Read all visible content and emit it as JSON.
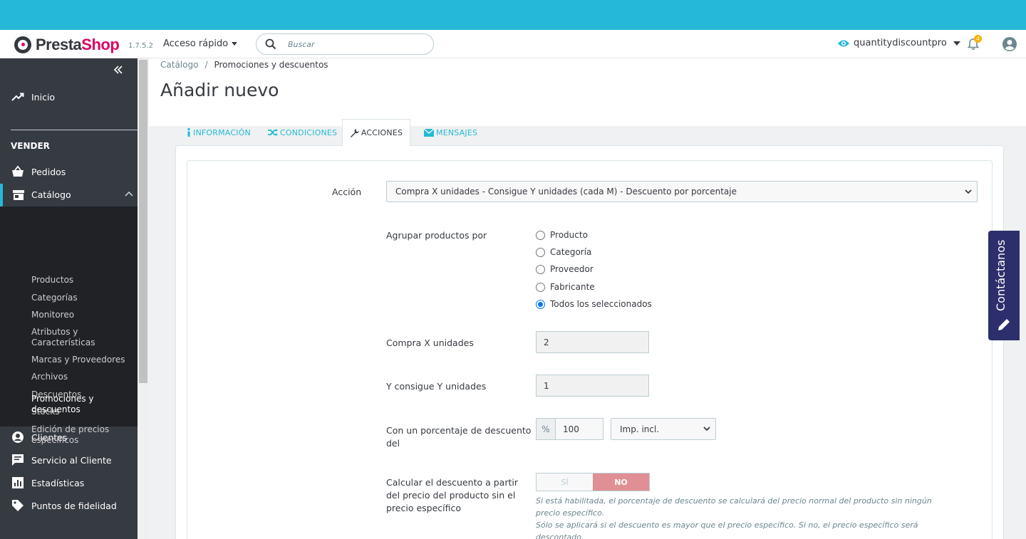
{
  "brand": {
    "name_a": "Presta",
    "name_b": "Shop",
    "version": "1.7.5.2"
  },
  "header": {
    "quick_access": "Acceso rápido",
    "search_placeholder": "Buscar",
    "shop_name": "quantitydiscountpro",
    "notifications": "4"
  },
  "sidebar": {
    "home": "Inicio",
    "section": "VENDER",
    "orders": "Pedidos",
    "catalog": "Catálogo",
    "catalog_items": [
      "Productos",
      "Categorías",
      "Monitoreo",
      "Atributos y Características",
      "Marcas y Proveedores",
      "Archivos",
      "Descuentos",
      "Stocks",
      "Edición de precios específicos",
      "Promociones y descuentos"
    ],
    "customers": "Clientes",
    "service": "Servicio al Cliente",
    "stats": "Estadísticas",
    "loyalty": "Puntos de fidelidad"
  },
  "breadcrumb": {
    "parent": "Catálogo",
    "current": "Promociones y descuentos"
  },
  "page_title": "Añadir nuevo",
  "tabs": [
    "INFORMACIÓN",
    "CONDICIONES",
    "ACCIONES",
    "MENSAJES"
  ],
  "form": {
    "action_label": "Acción",
    "action_value": "Compra X unidades - Consigue Y unidades (cada M) - Descuento por porcentaje",
    "group_label": "Agrupar productos por",
    "group_options": [
      "Producto",
      "Categoría",
      "Proveedor",
      "Fabricante",
      "Todos los seleccionados"
    ],
    "group_selected": "Todos los seleccionados",
    "buy_x_label": "Compra X unidades",
    "buy_x_value": "2",
    "get_y_label": "Y consigue Y unidades",
    "get_y_value": "1",
    "percent_label": "Con un porcentaje de descuento del",
    "percent_symbol": "%",
    "percent_value": "100",
    "tax_value": "Imp. incl.",
    "calc_label": "Calcular el descuento a partir del precio del producto sin el precio específico",
    "switch_yes": "SÍ",
    "switch_no": "NO",
    "switch_selected": "NO",
    "help_1": "Si está habilitada, el porcentaje de descuento se calculará del precio normal del producto sin ningún precio específico.",
    "help_2": "Sólo se aplicará si el descuento es mayor que el precio específico. Si no, el precio específico será descontado."
  },
  "contact_tab": "Contáctanos",
  "colors": {
    "accent": "#25b9d7",
    "sidebar": "#363a41",
    "danger_switch": "#e08f95",
    "contact": "#2c2f6b",
    "logo_pink": "#df0067"
  }
}
